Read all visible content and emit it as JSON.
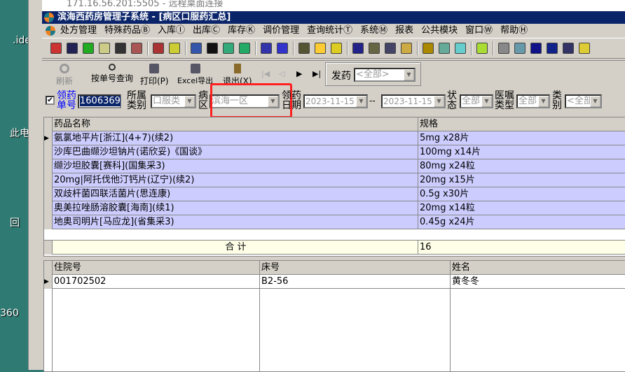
{
  "rdp_title": "171.16.56.201:5505 - 远程桌面连接",
  "desktop": {
    "icons": [
      ".ide",
      "此电",
      "回",
      "360"
    ]
  },
  "window": {
    "title": "滨海西药房管理子系统 - [病区口服药汇总]"
  },
  "menu": [
    "处方管理",
    "特殊药品Ⓑ",
    "入库Ⓘ",
    "出库Ⓒ",
    "库存Ⓚ",
    "调价管理",
    "查询统计Ⓣ",
    "系统Ⓜ",
    "报表",
    "公共模块",
    "窗口Ⓦ",
    "帮助Ⓗ"
  ],
  "toolbar_icons": [
    "nurse-icon",
    "bottle-icon",
    "check-icon",
    "edit-doc-icon",
    "binoculars-icon",
    "doc-colors-icon",
    "scan-icon",
    "sparkle-icon",
    "clipboard-add-icon",
    "checkbox-icon",
    "clipboard-icon",
    "doc-check-icon",
    "form-icon",
    "calendar-icon",
    "grid-icon",
    "bell-icon",
    "pu-icon",
    "jar-icon",
    "find-icon",
    "find2-icon",
    "tray-icon",
    "key-icon",
    "magnifier-icon",
    "close-box-icon",
    "folder-icon",
    "cube-icon",
    "zoom-icon",
    "list-icon",
    "windows-icon",
    "doc-tick-icon",
    "paste-icon"
  ],
  "actions": {
    "refresh": "刷新",
    "query": "按单号查询",
    "print": "打印(P)",
    "excel": "Excel导出",
    "exit": "退出(X)",
    "dispense_label": "发药",
    "dispense_value": "<全部>"
  },
  "filters": {
    "checked": true,
    "order_label": "领药单号",
    "order_value": "1606369",
    "category_label": "所属类别",
    "category_value": "口服类",
    "ward_label": "病区",
    "ward_value": "滨海一区",
    "date_label": "领药日期",
    "date_from": "2023-11-15",
    "date_sep": "--",
    "date_to": "2023-11-15",
    "status_label": "状态",
    "status_value": "全部",
    "order_type_label": "医嘱类型",
    "order_type_value": "全部",
    "type_label": "类别",
    "type_value": "<全部"
  },
  "drug_grid": {
    "headers": [
      "药品名称",
      "规格"
    ],
    "rows": [
      [
        "氨氯地平片[浙江](4+7)(续2)",
        "5mg x28片"
      ],
      [
        "沙库巴曲缬沙坦钠片(诺欣妥)《国谈》",
        "100mg x14片"
      ],
      [
        "缬沙坦胶囊[赛科](国集采3)",
        "80mg x24粒"
      ],
      [
        "20mg|阿托伐他汀钙片(辽宁)(续2)",
        "20mg x15片"
      ],
      [
        "双歧杆菌四联活菌片(思连康)",
        "0.5g x30片"
      ],
      [
        "奥美拉唑肠溶胶囊[海南](续1)",
        "20mg x14粒"
      ],
      [
        "地奥司明片[马应龙](省集采3)",
        "0.45g x24片"
      ]
    ],
    "total_label": "合  计",
    "total_value": "16"
  },
  "patient_grid": {
    "headers": [
      "住院号",
      "床号",
      "姓名"
    ],
    "rows": [
      [
        "001702502",
        "B2-56",
        "黄冬冬"
      ]
    ]
  },
  "colors": {
    "title_bar": "#0a246a",
    "selected_row": "#ccccff",
    "total_row": "#ffffe8",
    "highlight_box": "#ff2020"
  }
}
